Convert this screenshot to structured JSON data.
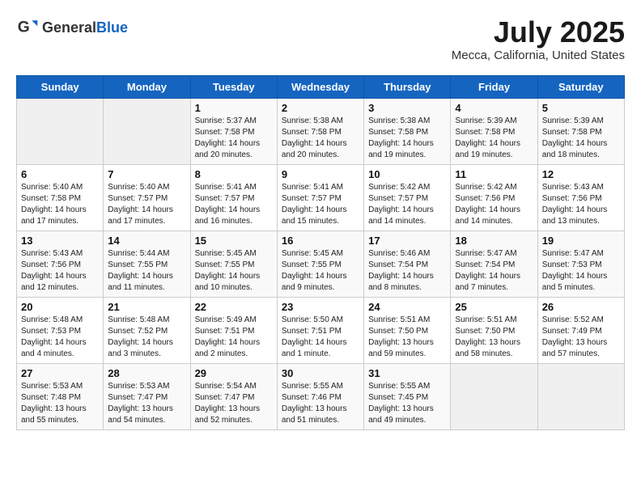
{
  "header": {
    "logo_general": "General",
    "logo_blue": "Blue",
    "title": "July 2025",
    "subtitle": "Mecca, California, United States"
  },
  "days_of_week": [
    "Sunday",
    "Monday",
    "Tuesday",
    "Wednesday",
    "Thursday",
    "Friday",
    "Saturday"
  ],
  "weeks": [
    [
      {
        "day": "",
        "sunrise": "",
        "sunset": "",
        "daylight": "",
        "empty": true
      },
      {
        "day": "",
        "sunrise": "",
        "sunset": "",
        "daylight": "",
        "empty": true
      },
      {
        "day": "1",
        "sunrise": "Sunrise: 5:37 AM",
        "sunset": "Sunset: 7:58 PM",
        "daylight": "Daylight: 14 hours and 20 minutes."
      },
      {
        "day": "2",
        "sunrise": "Sunrise: 5:38 AM",
        "sunset": "Sunset: 7:58 PM",
        "daylight": "Daylight: 14 hours and 20 minutes."
      },
      {
        "day": "3",
        "sunrise": "Sunrise: 5:38 AM",
        "sunset": "Sunset: 7:58 PM",
        "daylight": "Daylight: 14 hours and 19 minutes."
      },
      {
        "day": "4",
        "sunrise": "Sunrise: 5:39 AM",
        "sunset": "Sunset: 7:58 PM",
        "daylight": "Daylight: 14 hours and 19 minutes."
      },
      {
        "day": "5",
        "sunrise": "Sunrise: 5:39 AM",
        "sunset": "Sunset: 7:58 PM",
        "daylight": "Daylight: 14 hours and 18 minutes."
      }
    ],
    [
      {
        "day": "6",
        "sunrise": "Sunrise: 5:40 AM",
        "sunset": "Sunset: 7:58 PM",
        "daylight": "Daylight: 14 hours and 17 minutes."
      },
      {
        "day": "7",
        "sunrise": "Sunrise: 5:40 AM",
        "sunset": "Sunset: 7:57 PM",
        "daylight": "Daylight: 14 hours and 17 minutes."
      },
      {
        "day": "8",
        "sunrise": "Sunrise: 5:41 AM",
        "sunset": "Sunset: 7:57 PM",
        "daylight": "Daylight: 14 hours and 16 minutes."
      },
      {
        "day": "9",
        "sunrise": "Sunrise: 5:41 AM",
        "sunset": "Sunset: 7:57 PM",
        "daylight": "Daylight: 14 hours and 15 minutes."
      },
      {
        "day": "10",
        "sunrise": "Sunrise: 5:42 AM",
        "sunset": "Sunset: 7:57 PM",
        "daylight": "Daylight: 14 hours and 14 minutes."
      },
      {
        "day": "11",
        "sunrise": "Sunrise: 5:42 AM",
        "sunset": "Sunset: 7:56 PM",
        "daylight": "Daylight: 14 hours and 14 minutes."
      },
      {
        "day": "12",
        "sunrise": "Sunrise: 5:43 AM",
        "sunset": "Sunset: 7:56 PM",
        "daylight": "Daylight: 14 hours and 13 minutes."
      }
    ],
    [
      {
        "day": "13",
        "sunrise": "Sunrise: 5:43 AM",
        "sunset": "Sunset: 7:56 PM",
        "daylight": "Daylight: 14 hours and 12 minutes."
      },
      {
        "day": "14",
        "sunrise": "Sunrise: 5:44 AM",
        "sunset": "Sunset: 7:55 PM",
        "daylight": "Daylight: 14 hours and 11 minutes."
      },
      {
        "day": "15",
        "sunrise": "Sunrise: 5:45 AM",
        "sunset": "Sunset: 7:55 PM",
        "daylight": "Daylight: 14 hours and 10 minutes."
      },
      {
        "day": "16",
        "sunrise": "Sunrise: 5:45 AM",
        "sunset": "Sunset: 7:55 PM",
        "daylight": "Daylight: 14 hours and 9 minutes."
      },
      {
        "day": "17",
        "sunrise": "Sunrise: 5:46 AM",
        "sunset": "Sunset: 7:54 PM",
        "daylight": "Daylight: 14 hours and 8 minutes."
      },
      {
        "day": "18",
        "sunrise": "Sunrise: 5:47 AM",
        "sunset": "Sunset: 7:54 PM",
        "daylight": "Daylight: 14 hours and 7 minutes."
      },
      {
        "day": "19",
        "sunrise": "Sunrise: 5:47 AM",
        "sunset": "Sunset: 7:53 PM",
        "daylight": "Daylight: 14 hours and 5 minutes."
      }
    ],
    [
      {
        "day": "20",
        "sunrise": "Sunrise: 5:48 AM",
        "sunset": "Sunset: 7:53 PM",
        "daylight": "Daylight: 14 hours and 4 minutes."
      },
      {
        "day": "21",
        "sunrise": "Sunrise: 5:48 AM",
        "sunset": "Sunset: 7:52 PM",
        "daylight": "Daylight: 14 hours and 3 minutes."
      },
      {
        "day": "22",
        "sunrise": "Sunrise: 5:49 AM",
        "sunset": "Sunset: 7:51 PM",
        "daylight": "Daylight: 14 hours and 2 minutes."
      },
      {
        "day": "23",
        "sunrise": "Sunrise: 5:50 AM",
        "sunset": "Sunset: 7:51 PM",
        "daylight": "Daylight: 14 hours and 1 minute."
      },
      {
        "day": "24",
        "sunrise": "Sunrise: 5:51 AM",
        "sunset": "Sunset: 7:50 PM",
        "daylight": "Daylight: 13 hours and 59 minutes."
      },
      {
        "day": "25",
        "sunrise": "Sunrise: 5:51 AM",
        "sunset": "Sunset: 7:50 PM",
        "daylight": "Daylight: 13 hours and 58 minutes."
      },
      {
        "day": "26",
        "sunrise": "Sunrise: 5:52 AM",
        "sunset": "Sunset: 7:49 PM",
        "daylight": "Daylight: 13 hours and 57 minutes."
      }
    ],
    [
      {
        "day": "27",
        "sunrise": "Sunrise: 5:53 AM",
        "sunset": "Sunset: 7:48 PM",
        "daylight": "Daylight: 13 hours and 55 minutes."
      },
      {
        "day": "28",
        "sunrise": "Sunrise: 5:53 AM",
        "sunset": "Sunset: 7:47 PM",
        "daylight": "Daylight: 13 hours and 54 minutes."
      },
      {
        "day": "29",
        "sunrise": "Sunrise: 5:54 AM",
        "sunset": "Sunset: 7:47 PM",
        "daylight": "Daylight: 13 hours and 52 minutes."
      },
      {
        "day": "30",
        "sunrise": "Sunrise: 5:55 AM",
        "sunset": "Sunset: 7:46 PM",
        "daylight": "Daylight: 13 hours and 51 minutes."
      },
      {
        "day": "31",
        "sunrise": "Sunrise: 5:55 AM",
        "sunset": "Sunset: 7:45 PM",
        "daylight": "Daylight: 13 hours and 49 minutes."
      },
      {
        "day": "",
        "sunrise": "",
        "sunset": "",
        "daylight": "",
        "empty": true
      },
      {
        "day": "",
        "sunrise": "",
        "sunset": "",
        "daylight": "",
        "empty": true
      }
    ]
  ]
}
